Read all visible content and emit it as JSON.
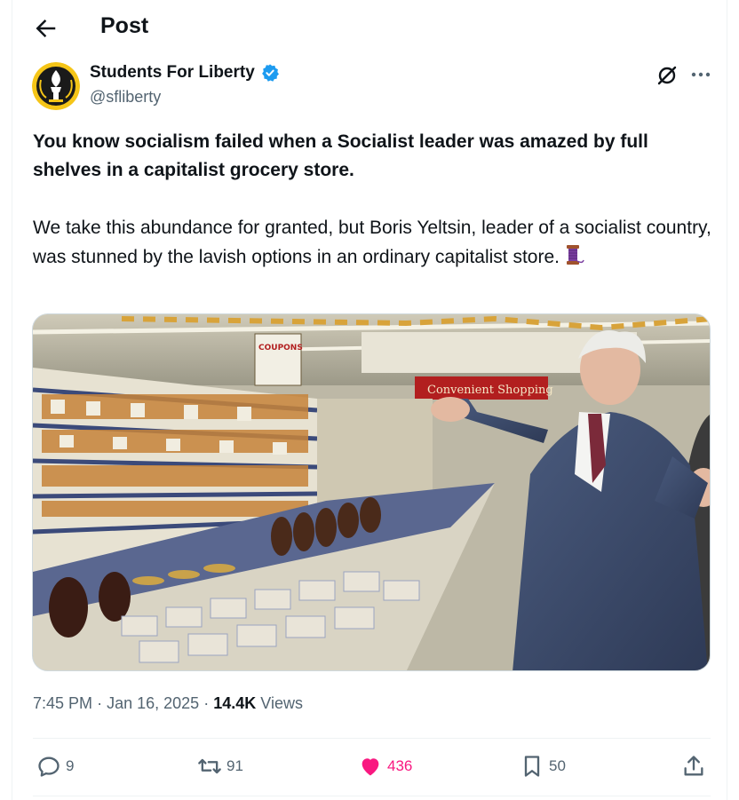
{
  "header": {
    "title": "Post"
  },
  "author": {
    "name": "Students For Liberty",
    "handle": "@sfliberty"
  },
  "post": {
    "headline": "You know socialism failed when a Socialist leader was amazed by full shelves in a capitalist grocery store.",
    "body": "We take this abundance for granted, but Boris Yeltsin, leader of a socialist country, was stunned by the lavish options in an ordinary capitalist store.",
    "emoji": "thread-emoji",
    "photo_signs": {
      "coupons": "COUPONS",
      "store_sign": "Convenient Shopping"
    }
  },
  "meta": {
    "time": "7:45 PM",
    "date": "Jan 16, 2025",
    "views_count": "14.4K",
    "views_label": "Views",
    "separator": "·"
  },
  "actions": {
    "replies": "9",
    "reposts": "91",
    "likes": "436",
    "bookmarks": "50"
  },
  "colors": {
    "accent_like": "#f91880",
    "verified": "#1d9bf0",
    "muted": "#536471"
  }
}
